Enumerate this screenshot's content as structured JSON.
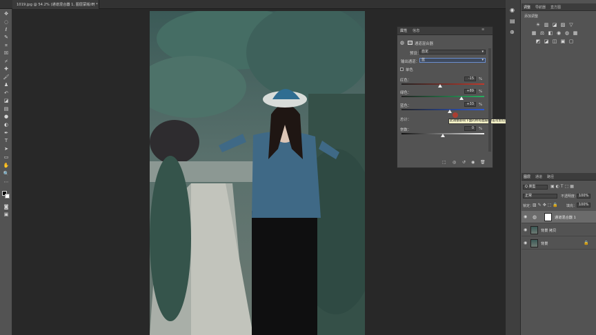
{
  "document": {
    "tab_title": "1019.jpg @ 54.2% (通道混合器 1, 图层蒙版/8) *",
    "close_glyph": "×"
  },
  "tools": [
    "move-icon",
    "marquee-icon",
    "lasso-icon",
    "quick-select-icon",
    "crop-icon",
    "frame-icon",
    "eyedropper-icon",
    "healing-icon",
    "brush-icon",
    "stamp-icon",
    "history-brush-icon",
    "eraser-icon",
    "gradient-icon",
    "blur-icon",
    "dodge-icon",
    "pen-icon",
    "type-icon",
    "path-select-icon",
    "rectangle-icon",
    "hand-icon",
    "zoom-icon",
    "more-icon"
  ],
  "properties": {
    "tabs": [
      "属性",
      "信息"
    ],
    "adjustment_title": "通道混合器",
    "preset_label": "预设：",
    "preset_value": "自定",
    "output_channel_label": "输出通道：",
    "output_channel_value": "蓝",
    "monochrome_label": "单色",
    "red_label": "红色：",
    "red_value": "-15",
    "green_label": "绿色：",
    "green_value": "+89",
    "blue_label": "蓝色：",
    "blue_value": "+33",
    "total_label": "总计：",
    "constant_label": "常数：",
    "constant_value": "0",
    "percent": "%",
    "tooltip": "此调整影响下面的所有图层(单击可剪切到图层)",
    "slider_levels": {
      "red": -15,
      "green": 89,
      "blue": 33,
      "constant": 0
    }
  },
  "dock": {
    "top_tabs": [
      "调整",
      "导航器",
      "直方图"
    ],
    "add_adjustment_label": "添加调整",
    "layers_tabs": [
      "图层",
      "通道",
      "路径"
    ],
    "filter_kind": "Q 类型",
    "blend_mode": "正常",
    "opacity_label": "不透明度：",
    "opacity_value": "100%",
    "lock_label": "锁定：",
    "fill_label": "填充：",
    "fill_value": "100%",
    "layers": [
      {
        "name": "通道混合器 1",
        "selected": true
      },
      {
        "name": "背景 拷贝",
        "selected": false
      },
      {
        "name": "背景",
        "selected": false
      }
    ]
  },
  "colors": {
    "panel": "#535353",
    "canvas": "#282828",
    "highlight": "#6b6b6b"
  }
}
